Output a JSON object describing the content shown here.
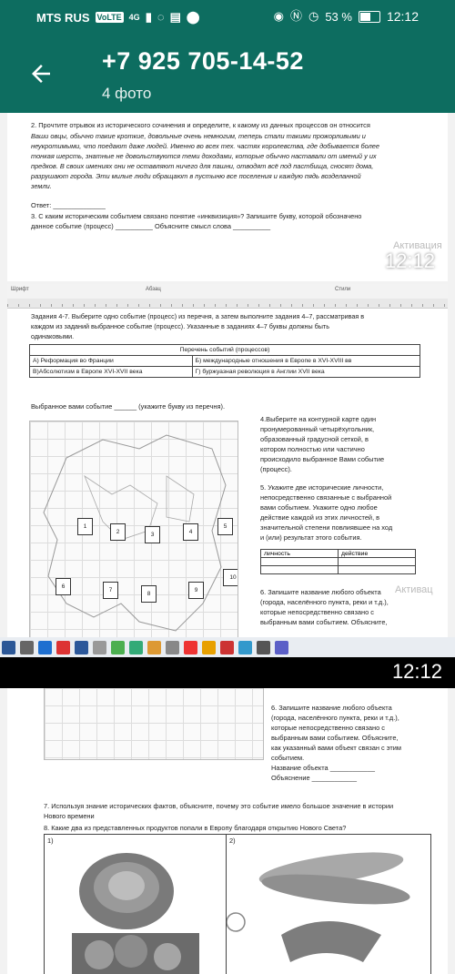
{
  "status_bar": {
    "carrier": "MTS RUS",
    "volte": "VoLTE",
    "network": "4G",
    "battery": "53 %",
    "time": "12:12"
  },
  "app_bar": {
    "title": "+7 925 705-14-52",
    "subtitle": "4 фото"
  },
  "photo1": {
    "task2": "2. Прочтите отрывок из исторического сочинения и определите, к какому из данных процессов он относится",
    "quote": [
      "Ваши овцы, обычно такие кроткие, довольные очень немногим, теперь стали такими прожорливыми и",
      "неукротимыми, что поедают даже людей. Именно во всех тех. частях королевства, где добывается более",
      "тонкая шерсть, знатные не довольствуются теми доходами, которые обычно наставали от имений у их",
      "предков. В своих имениях они не оставляют ничего для пашни, отводят всё под пастбища, сносят дома,",
      "разрушают города. Эти милые люди обращают в пустыню все поселения и каждую пядь возделанной",
      "земли."
    ],
    "answer": "Ответ: ______________",
    "task3": "3. С каким историческим событием связано понятие «инквизиция»? Запишите букву, которой обозначено",
    "task3b": "данное событие (процесс) __________ Объясните смысл слова __________",
    "watermark": "Активация",
    "timestamp": "12:12"
  },
  "photo2": {
    "ribbon": [
      "Шрифт",
      "Абзац",
      "Стили"
    ],
    "heading": [
      "Задания 4-7. Выберите одно событие (процесс) из перечня, а затем выполните задания 4–7, рассматривая в",
      "каждом из заданий выбранное событие (процесс). Указанные в заданиях 4–7 буквы должны быть",
      "одинаковыми."
    ],
    "table_title": "Перечень событий (процессов)",
    "events": [
      [
        "А) Реформация во Франции",
        "Б) международные отношения в Европе в XVI-XVIII вв"
      ],
      [
        "В)Абсолютизм в Европе XVI-XVII века",
        "Г) буржуазная революция в Англии XVII века"
      ]
    ],
    "chosen": "Выбранное вами событие ______ (укажите букву из перечня).",
    "task4": [
      "4.Выберите на контурной карте один",
      "пронумерованный четырёхугольник,",
      "образованный градусной сеткой, в",
      "котором полностью или частично",
      "происходило выбранное Вами событие",
      "(процесс)."
    ],
    "task5": [
      "5. Укажите две исторические личности,",
      "непосредственно связанные с выбранной",
      "вами событием. Укажите одно любое",
      "действие каждой из этих личностей, в",
      "значительной степени повлиявшее на ход",
      "и (или) результат этого события."
    ],
    "table_headers": [
      "личность",
      "действие"
    ],
    "task6": [
      "6. Запишите название любого объекта",
      "(города, населённого пункта, реки и т.д.),",
      "которые непосредственно связано с",
      "выбранным вами событием. Объясните,"
    ],
    "map_boxes": [
      "1",
      "2",
      "3",
      "4",
      "5",
      "6",
      "7",
      "8",
      "9",
      "10"
    ],
    "watermark": "Активац",
    "timestamp": "12:12"
  },
  "photo3": {
    "task6": [
      "6. Запишите название любого объекта",
      "(города, населённого пункта, реки и т.д.),",
      "которые непосредственно связано с",
      "выбранным вами событием. Объясните,",
      "как указанный вами объект связан с этим",
      "событием.",
      "Название объекта ____________",
      "Объяснение ____________"
    ],
    "task7": [
      "7. Используя знание исторических фактов, объясните, почему это событие имело большое значение в истории",
      "Нового времени"
    ],
    "task8": "8. Какие два из представленных продуктов попали в Европу благодаря открытию Нового Света?",
    "cells": [
      "1)",
      "2)"
    ]
  }
}
